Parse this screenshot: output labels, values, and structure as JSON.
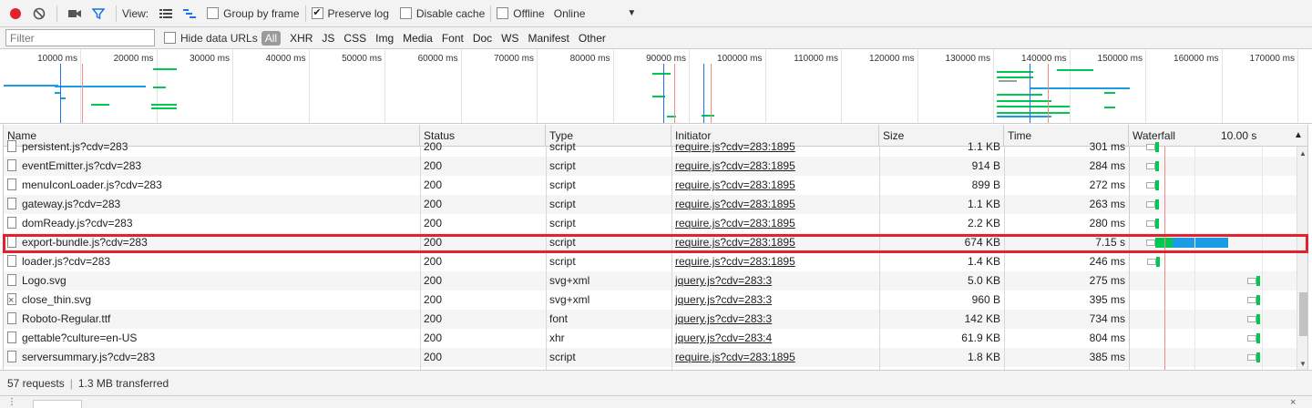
{
  "toolbar": {
    "view_label": "View:",
    "group_by_frame": "Group by frame",
    "preserve_log": "Preserve log",
    "disable_cache": "Disable cache",
    "offline": "Offline",
    "throttle": "Online"
  },
  "filterbar": {
    "placeholder": "Filter",
    "hide_data_urls": "Hide data URLs",
    "types": [
      "All",
      "XHR",
      "JS",
      "CSS",
      "Img",
      "Media",
      "Font",
      "Doc",
      "WS",
      "Manifest",
      "Other"
    ]
  },
  "overview": {
    "ticks": [
      "10000 ms",
      "20000 ms",
      "30000 ms",
      "40000 ms",
      "50000 ms",
      "60000 ms",
      "70000 ms",
      "80000 ms",
      "90000 ms",
      "100000 ms",
      "110000 ms",
      "120000 ms",
      "130000 ms",
      "140000 ms",
      "150000 ms",
      "160000 ms",
      "170000 ms"
    ]
  },
  "grid": {
    "headers": {
      "name": "Name",
      "status": "Status",
      "type": "Type",
      "initiator": "Initiator",
      "size": "Size",
      "time": "Time",
      "waterfall": "Waterfall",
      "waterfall_scale": "10.00 s"
    },
    "rows": [
      {
        "name": "persistent.js?cdv=283",
        "status": "200",
        "type": "script",
        "initiator": "require.js?cdv=283:1895",
        "size": "1.1 KB",
        "time": "301 ms",
        "icon": "file-icon",
        "wf_start": 0.155,
        "wf_end": 0.16
      },
      {
        "name": "eventEmitter.js?cdv=283",
        "status": "200",
        "type": "script",
        "initiator": "require.js?cdv=283:1895",
        "size": "914 B",
        "time": "284 ms",
        "icon": "file-icon",
        "wf_start": 0.156,
        "wf_end": 0.161
      },
      {
        "name": "menuIconLoader.js?cdv=283",
        "status": "200",
        "type": "script",
        "initiator": "require.js?cdv=283:1895",
        "size": "899 B",
        "time": "272 ms",
        "icon": "file-icon",
        "wf_start": 0.157,
        "wf_end": 0.162
      },
      {
        "name": "gateway.js?cdv=283",
        "status": "200",
        "type": "script",
        "initiator": "require.js?cdv=283:1895",
        "size": "1.1 KB",
        "time": "263 ms",
        "icon": "file-icon",
        "wf_start": 0.158,
        "wf_end": 0.163
      },
      {
        "name": "domReady.js?cdv=283",
        "status": "200",
        "type": "script",
        "initiator": "require.js?cdv=283:1895",
        "size": "2.2 KB",
        "time": "280 ms",
        "icon": "file-icon",
        "wf_start": 0.159,
        "wf_end": 0.164
      },
      {
        "name": "export-bundle.js?cdv=283",
        "status": "200",
        "type": "script",
        "initiator": "require.js?cdv=283:1895",
        "size": "674 KB",
        "time": "7.15 s",
        "icon": "file-icon",
        "wf_start": 0.16,
        "wf_end": 0.59,
        "highlighted": true
      },
      {
        "name": "loader.js?cdv=283",
        "status": "200",
        "type": "script",
        "initiator": "require.js?cdv=283:1895",
        "size": "1.4 KB",
        "time": "246 ms",
        "icon": "file-icon",
        "wf_start": 0.162,
        "wf_end": 0.167
      },
      {
        "name": "Logo.svg",
        "status": "200",
        "type": "svg+xml",
        "initiator": "jquery.js?cdv=283:3",
        "size": "5.0 KB",
        "time": "275 ms",
        "icon": "file-icon",
        "wf_start": 0.76,
        "wf_end": 0.765
      },
      {
        "name": "close_thin.svg",
        "status": "200",
        "type": "svg+xml",
        "initiator": "jquery.js?cdv=283:3",
        "size": "960 B",
        "time": "395 ms",
        "icon": "broken-image-icon",
        "wf_start": 0.76,
        "wf_end": 0.767
      },
      {
        "name": "Roboto-Regular.ttf",
        "status": "200",
        "type": "font",
        "initiator": "jquery.js?cdv=283:3",
        "size": "142 KB",
        "time": "734 ms",
        "icon": "file-icon",
        "wf_start": 0.76,
        "wf_end": 0.775
      },
      {
        "name": "gettable?culture=en-US",
        "status": "200",
        "type": "xhr",
        "initiator": "jquery.js?cdv=283:4",
        "size": "61.9 KB",
        "time": "804 ms",
        "icon": "file-icon",
        "wf_start": 0.76,
        "wf_end": 0.775
      },
      {
        "name": "serversummary.js?cdv=283",
        "status": "200",
        "type": "script",
        "initiator": "require.js?cdv=283:1895",
        "size": "1.8 KB",
        "time": "385 ms",
        "icon": "file-icon",
        "wf_start": 0.76,
        "wf_end": 0.767
      }
    ]
  },
  "status": {
    "requests": "57 requests",
    "transferred": "1.3 MB transferred"
  },
  "colors": {
    "record": "#e3222d",
    "filter_active": "#1a73e8",
    "highlight_border": "#e3222d",
    "waterfall_green": "#00c853",
    "waterfall_blue": "#1a9be6"
  }
}
